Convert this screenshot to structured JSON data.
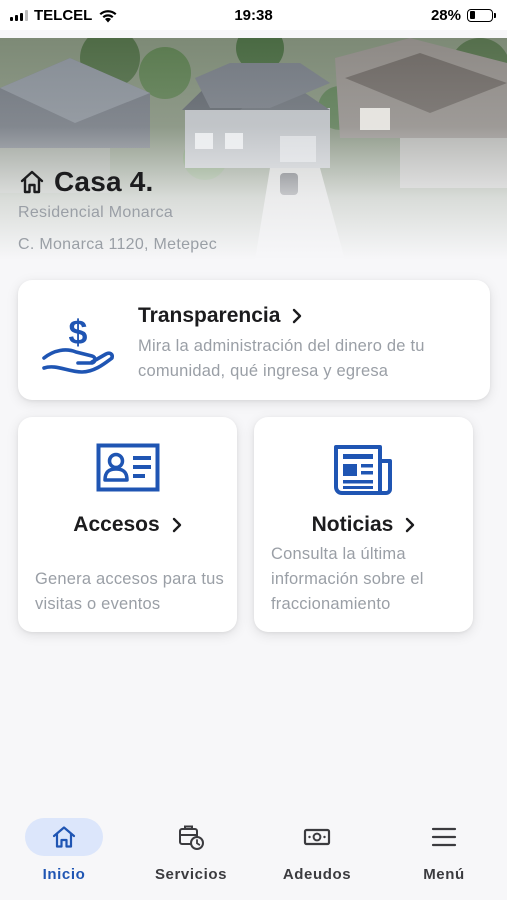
{
  "status_bar": {
    "carrier": "TELCEL",
    "time": "19:38",
    "battery_percent": "28%",
    "battery_level": 0.28
  },
  "header": {
    "house_name": "Casa 4.",
    "community": "Residencial Monarca",
    "address": "C. Monarca 1120, Metepec",
    "icon": "home-outline-icon"
  },
  "cards": {
    "transparencia": {
      "title": "Transparencia",
      "description": "Mira la administración del dinero de tu comunidad, qué ingresa y egresa",
      "icon": "hand-dollar-icon"
    },
    "accesos": {
      "title": "Accesos",
      "description": "Genera accesos para tus visitas o eventos",
      "icon": "id-card-icon"
    },
    "noticias": {
      "title": "Noticias",
      "description": "Consulta la última información sobre el fraccionamiento",
      "icon": "newspaper-icon"
    }
  },
  "bottom_nav": {
    "items": [
      {
        "label": "Inicio",
        "icon": "home-icon",
        "active": true
      },
      {
        "label": "Servicios",
        "icon": "services-clock-icon",
        "active": false
      },
      {
        "label": "Adeudos",
        "icon": "money-bill-icon",
        "active": false
      },
      {
        "label": "Menú",
        "icon": "hamburger-menu-icon",
        "active": false
      }
    ]
  },
  "colors": {
    "brand_blue": "#1f55b3",
    "active_nav_bg": "#dce6fb",
    "muted_text": "#9a9fa6"
  }
}
